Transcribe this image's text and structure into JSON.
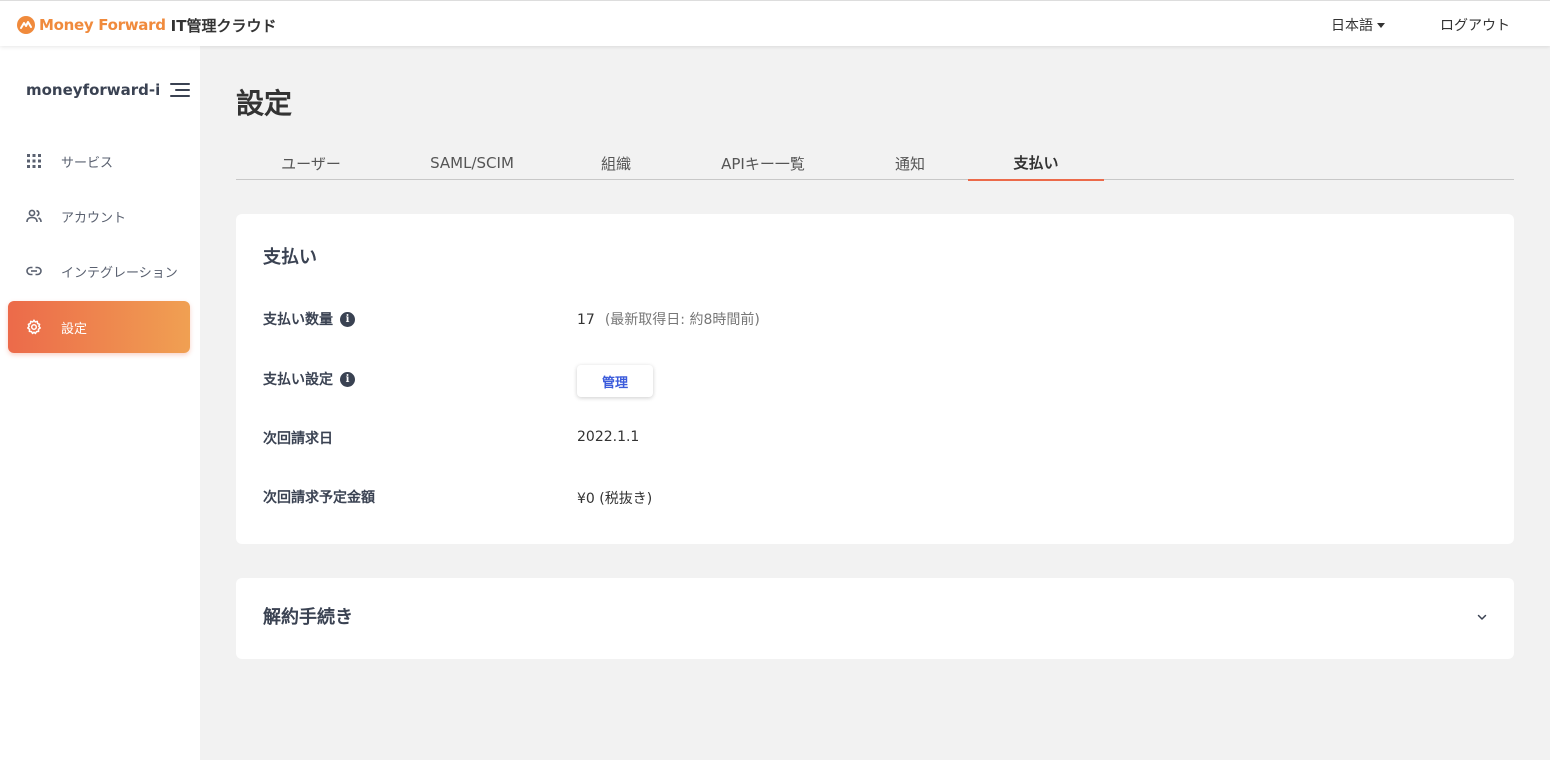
{
  "header": {
    "logo_text": "Money Forward",
    "product_name": "IT管理クラウド",
    "language": "日本語",
    "logout": "ログアウト"
  },
  "sidebar": {
    "org_name": "moneyforward-i",
    "items": [
      {
        "label": "サービス",
        "icon": "grid-icon"
      },
      {
        "label": "アカウント",
        "icon": "users-icon"
      },
      {
        "label": "インテグレーション",
        "icon": "link-icon"
      },
      {
        "label": "設定",
        "icon": "gear-icon",
        "active": true
      }
    ]
  },
  "page": {
    "title": "設定",
    "tabs": [
      {
        "label": "ユーザー"
      },
      {
        "label": "SAML/SCIM"
      },
      {
        "label": "組織"
      },
      {
        "label": "APIキー一覧"
      },
      {
        "label": "通知"
      },
      {
        "label": "支払い",
        "active": true
      }
    ]
  },
  "payment": {
    "title": "支払い",
    "count_label": "支払い数量",
    "count_value": "17",
    "count_note": "(最新取得日: 約8時間前)",
    "settings_label": "支払い設定",
    "manage_button": "管理",
    "next_billing_label": "次回請求日",
    "next_billing_value": "2022.1.1",
    "next_amount_label": "次回請求予定金額",
    "next_amount_value": "¥0 (税抜き)"
  },
  "cancellation": {
    "title": "解約手続き"
  },
  "colors": {
    "accent": "#ec6a4a",
    "accent_end": "#f0a052",
    "brand": "#f08a3c",
    "link": "#3b5bdb"
  }
}
